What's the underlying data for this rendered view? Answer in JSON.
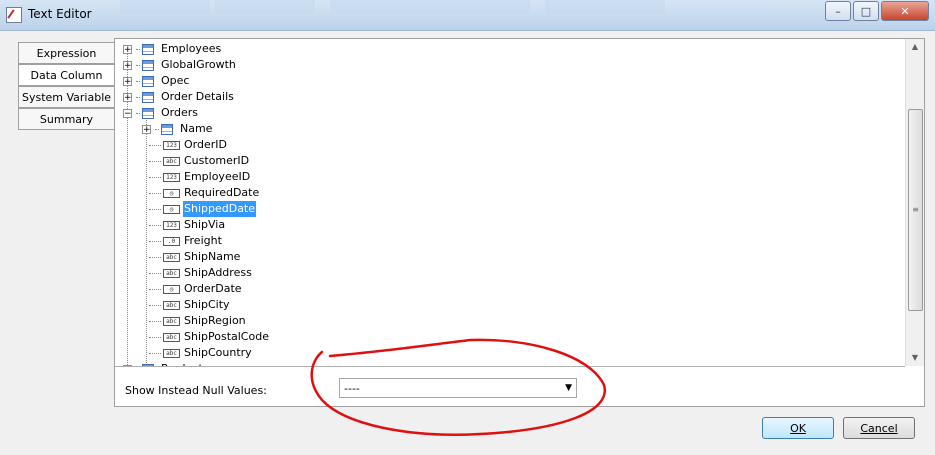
{
  "window": {
    "title": "Text Editor",
    "minimize_glyph": "–",
    "maximize_glyph": "□",
    "close_glyph": "✕"
  },
  "tabs": [
    {
      "label": "Expression",
      "active": false
    },
    {
      "label": "Data Column",
      "active": true
    },
    {
      "label": "System Variable",
      "active": false
    },
    {
      "label": "Summary",
      "active": false
    }
  ],
  "tree": {
    "tables": [
      {
        "label": "Employees",
        "expander": "+"
      },
      {
        "label": "GlobalGrowth",
        "expander": "+"
      },
      {
        "label": "Opec",
        "expander": "+"
      },
      {
        "label": "Order Details",
        "expander": "+"
      },
      {
        "label": "Orders",
        "expander": "−"
      }
    ],
    "orders_relation": {
      "label": "Name",
      "expander": "+"
    },
    "orders_fields": [
      {
        "label": "OrderID",
        "type": "123",
        "selected": false
      },
      {
        "label": "CustomerID",
        "type": "abc",
        "selected": false
      },
      {
        "label": "EmployeeID",
        "type": "123",
        "selected": false
      },
      {
        "label": "RequiredDate",
        "type": "◷",
        "selected": false
      },
      {
        "label": "ShippedDate",
        "type": "◷",
        "selected": true
      },
      {
        "label": "ShipVia",
        "type": "123",
        "selected": false
      },
      {
        "label": "Freight",
        "type": ".0",
        "selected": false
      },
      {
        "label": "ShipName",
        "type": "abc",
        "selected": false
      },
      {
        "label": "ShipAddress",
        "type": "abc",
        "selected": false
      },
      {
        "label": "OrderDate",
        "type": "◷",
        "selected": false
      },
      {
        "label": "ShipCity",
        "type": "abc",
        "selected": false
      },
      {
        "label": "ShipRegion",
        "type": "abc",
        "selected": false
      },
      {
        "label": "ShipPostalCode",
        "type": "abc",
        "selected": false
      },
      {
        "label": "ShipCountry",
        "type": "abc",
        "selected": false
      }
    ],
    "next_table": {
      "label": "Products",
      "expander": "+"
    }
  },
  "scrollbar": {
    "up_glyph": "▲",
    "down_glyph": "▼",
    "thumb_grip": "≡"
  },
  "null_values": {
    "label": "Show Instead Null Values:",
    "value": "----",
    "arrow_glyph": "▼"
  },
  "buttons": {
    "ok_label": "OK",
    "cancel_label": "Cancel"
  },
  "colors": {
    "selection": "#3399ff",
    "annotation": "#e01010"
  }
}
